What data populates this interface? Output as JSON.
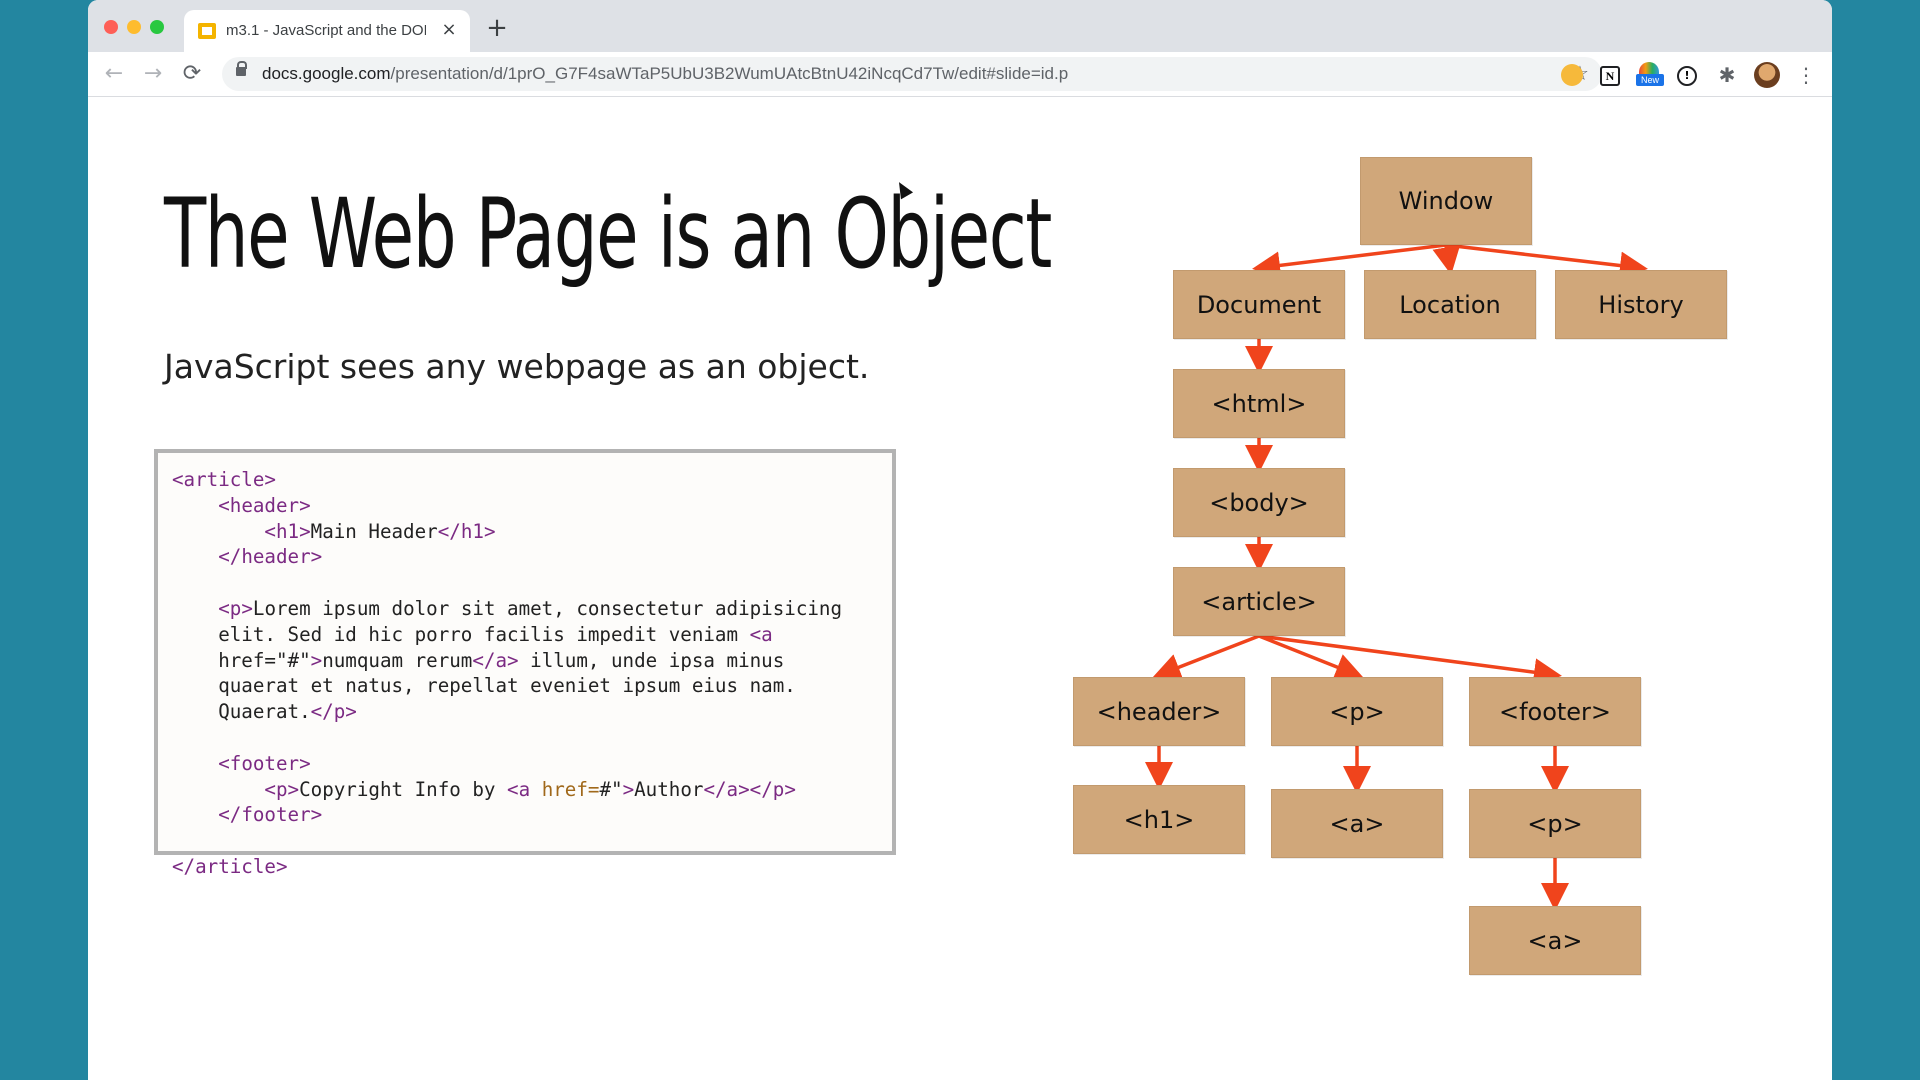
{
  "browser": {
    "tab_title": "m3.1 - JavaScript and the DOM",
    "tab_close": "×",
    "new_tab": "+",
    "url_host": "docs.google.com",
    "url_path": "/presentation/d/1prO_G7F4saWTaP5UbU3B2WumUAtcBtnU42iNcqCd7Tw/edit#slide=id.p",
    "nav_back": "←",
    "nav_forward": "→",
    "nav_reload": "⟳",
    "star": "☆",
    "extension_badge": "New",
    "menu": "⋮"
  },
  "slide": {
    "title": "The Web Page is an Object",
    "subtitle": "JavaScript sees any webpage as an object.",
    "code_lines": [
      "<article>",
      "    <header>",
      "        <h1>Main Header</h1>",
      "    </header>",
      "",
      "    <p>Lorem ipsum dolor sit amet, consectetur adipisicing",
      "    elit. Sed id hic porro facilis impedit veniam <a",
      "    href=\"#\">numquam rerum</a> illum, unde ipsa minus",
      "    quaerat et natus, repellat eveniet ipsum eius nam.",
      "    Quaerat.</p>",
      "",
      "    <footer>",
      "        <p>Copyright Info by <a href=\"#\">Author</a></p>",
      "    </footer>",
      "",
      "</article>"
    ]
  },
  "diagram": {
    "nodes": {
      "window": "Window",
      "document": "Document",
      "location": "Location",
      "history": "History",
      "html": "<html>",
      "body": "<body>",
      "article": "<article>",
      "header": "<header>",
      "p": "<p>",
      "footer": "<footer>",
      "h1": "<h1>",
      "p_a": "<a>",
      "footer_p": "<p>",
      "footer_p_a": "<a>"
    },
    "edges": [
      [
        "window",
        "document"
      ],
      [
        "window",
        "location"
      ],
      [
        "window",
        "history"
      ],
      [
        "document",
        "html"
      ],
      [
        "html",
        "body"
      ],
      [
        "body",
        "article"
      ],
      [
        "article",
        "header"
      ],
      [
        "article",
        "p"
      ],
      [
        "article",
        "footer"
      ],
      [
        "header",
        "h1"
      ],
      [
        "p",
        "p_a"
      ],
      [
        "footer",
        "footer_p"
      ],
      [
        "footer_p",
        "footer_p_a"
      ]
    ],
    "colors": {
      "node": "#d0a77a",
      "arrow": "#f0441c"
    }
  }
}
